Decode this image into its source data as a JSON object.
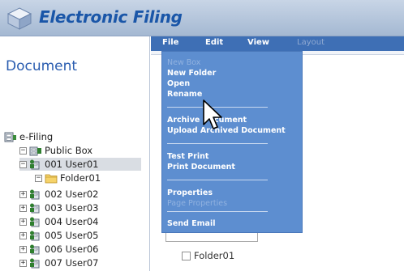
{
  "header": {
    "title": "Electronic Filing",
    "logo_icon": "cube-logo-icon"
  },
  "sidebar": {
    "heading": "Document",
    "tree": [
      {
        "label": "e-Filing",
        "icon": "filing-cabinet-icon",
        "expander": ""
      },
      {
        "label": "Public Box",
        "icon": "box-icon",
        "expander": "−"
      },
      {
        "label": "001 User01",
        "icon": "user-box-icon",
        "expander": "−",
        "selected": true
      },
      {
        "label": "Folder01",
        "icon": "folder-icon",
        "expander": "−"
      },
      {
        "label": "002 User02",
        "icon": "user-box-icon",
        "expander": "+"
      },
      {
        "label": "003 User03",
        "icon": "user-box-icon",
        "expander": "+"
      },
      {
        "label": "004 User04",
        "icon": "user-box-icon",
        "expander": "+"
      },
      {
        "label": "005 User05",
        "icon": "user-box-icon",
        "expander": "+"
      },
      {
        "label": "006 User06",
        "icon": "user-box-icon",
        "expander": "+"
      },
      {
        "label": "007 User07",
        "icon": "user-box-icon",
        "expander": "+"
      }
    ]
  },
  "menubar": {
    "file": "File",
    "edit": "Edit",
    "view": "View",
    "layout": "Layout"
  },
  "file_menu": {
    "new_box": "New Box",
    "new_folder": "New Folder",
    "open": "Open",
    "rename": "Rename",
    "archive_document": "Archive Document",
    "upload_archived_document": "Upload Archived Document",
    "test_print": "Test Print",
    "print_document": "Print Document",
    "properties": "Properties",
    "page_properties": "Page Properties",
    "send_email": "Send Email"
  },
  "content": {
    "folder_item": "Folder01"
  },
  "colors": {
    "menubar": "#3e6fb5",
    "dropdown": "#5d8ed0",
    "title": "#1a56a8",
    "heading": "#2a5db0"
  }
}
